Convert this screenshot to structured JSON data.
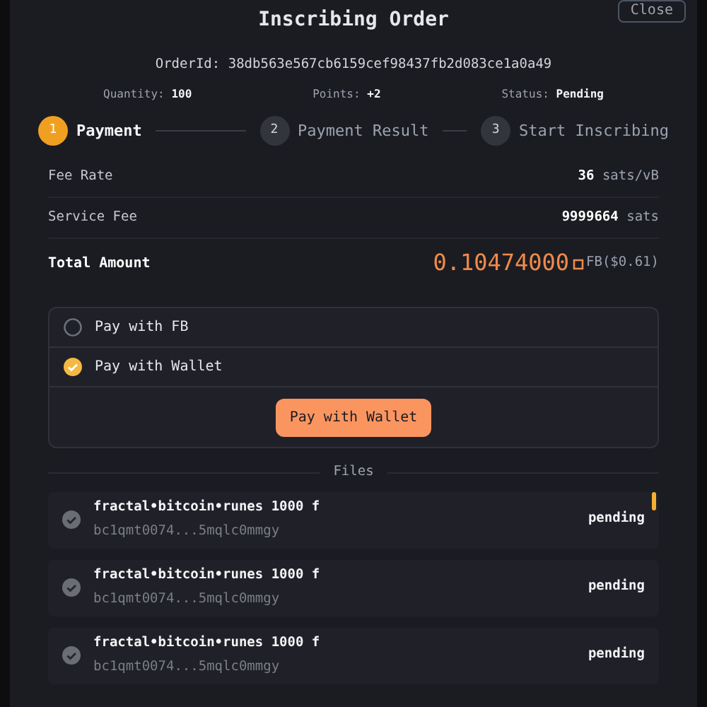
{
  "dialog": {
    "title": "Inscribing Order",
    "close_button": "Close",
    "order_id": {
      "label": "OrderId:",
      "value": "38db563e567cb6159cef98437fb2d083ce1a0a49"
    },
    "stats": [
      {
        "label": "Quantity:",
        "value": "100"
      },
      {
        "label": "Points:",
        "value": "+2"
      },
      {
        "label": "Status:",
        "value": "Pending"
      }
    ],
    "steps": [
      {
        "number": "1",
        "label": "Payment",
        "selected": true
      },
      {
        "number": "2",
        "label": "Payment Result",
        "selected": false
      },
      {
        "number": "3",
        "label": "Start Inscribing",
        "selected": false
      }
    ],
    "fees": [
      {
        "label": "Fee Rate",
        "value": "36",
        "unit": "sats/vB"
      },
      {
        "label": "Service Fee",
        "value": "9999664",
        "unit": "sats"
      }
    ],
    "total": {
      "label": "Total Amount",
      "value": "0.10474000",
      "unit": "FB($0.61)"
    },
    "payment_options": [
      {
        "label": "Pay with FB",
        "selected": false
      },
      {
        "label": "Pay with Wallet",
        "selected": true
      }
    ],
    "pay_button": "Pay with Wallet",
    "files_heading": "Files",
    "files": [
      {
        "name": "fractal•bitcoin•runes 1000 f",
        "address": "bc1qmt0074...5mqlc0mmgy",
        "status": "pending"
      },
      {
        "name": "fractal•bitcoin•runes 1000 f",
        "address": "bc1qmt0074...5mqlc0mmgy",
        "status": "pending"
      },
      {
        "name": "fractal•bitcoin•runes 1000 f",
        "address": "bc1qmt0074...5mqlc0mmgy",
        "status": "pending"
      }
    ]
  }
}
